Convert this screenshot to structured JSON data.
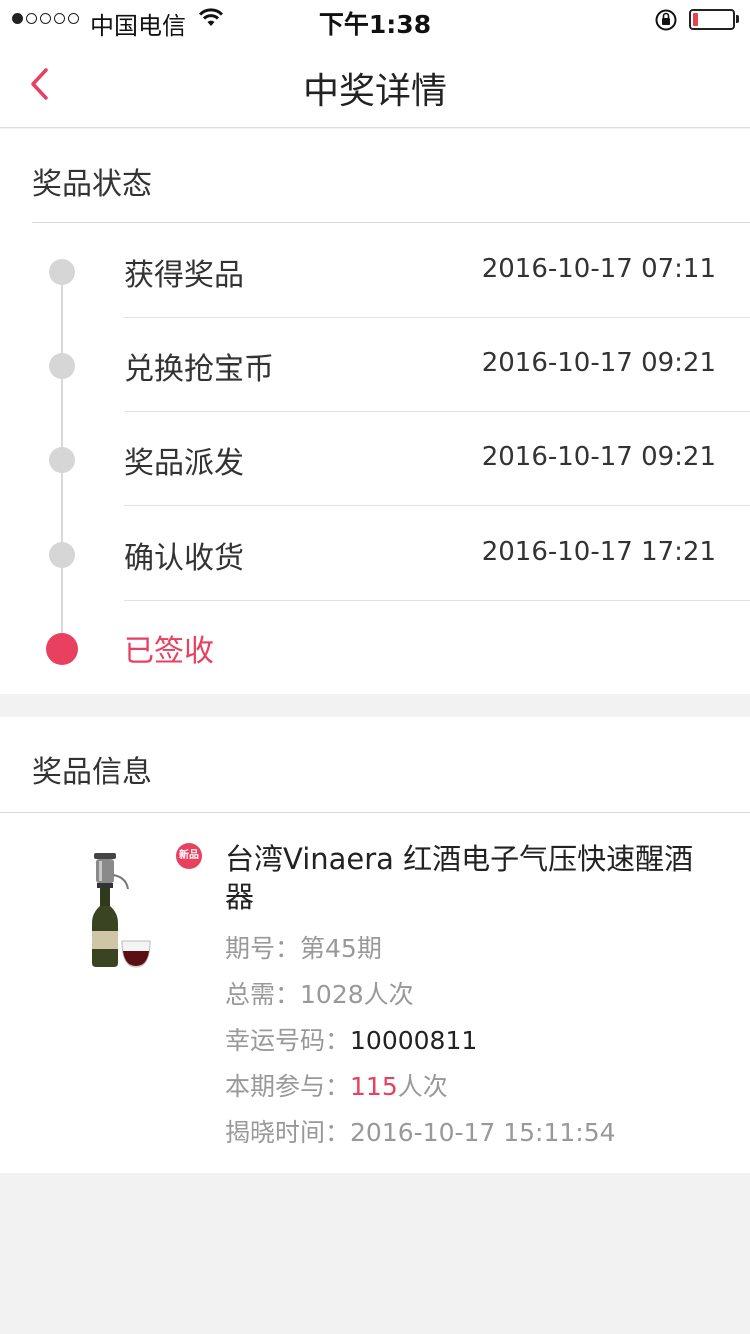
{
  "status_bar": {
    "signal_dots_filled": 1,
    "signal_dots_total": 5,
    "carrier": "中国电信",
    "time": "下午1:38",
    "battery_level": 0.12
  },
  "nav": {
    "title": "中奖详情"
  },
  "prize_status": {
    "title": "奖品状态",
    "steps": [
      {
        "label": "获得奖品",
        "time": "2016-10-17 07:11"
      },
      {
        "label": "兑换抢宝币",
        "time": "2016-10-17 09:21"
      },
      {
        "label": "奖品派发",
        "time": "2016-10-17 09:21"
      },
      {
        "label": "确认收货",
        "time": "2016-10-17 17:21"
      },
      {
        "label": "已签收",
        "time": ""
      }
    ]
  },
  "prize_info": {
    "title": "奖品信息",
    "badge": "新品",
    "product_name": "台湾Vinaera 红酒电子气压快速醒酒器",
    "period_label": "期号：",
    "period_value": "第45期",
    "total_label": "总需：",
    "total_value": "1028人次",
    "lucky_label": "幸运号码：",
    "lucky_value": "10000811",
    "joined_label": "本期参与：",
    "joined_count": "115",
    "joined_unit": "人次",
    "reveal_label": "揭晓时间：",
    "reveal_value": "2016-10-17 15:11:54"
  },
  "colors": {
    "accent": "#e8405e",
    "dot_inactive": "#d6d6d6",
    "background": "#f2f2f2"
  }
}
